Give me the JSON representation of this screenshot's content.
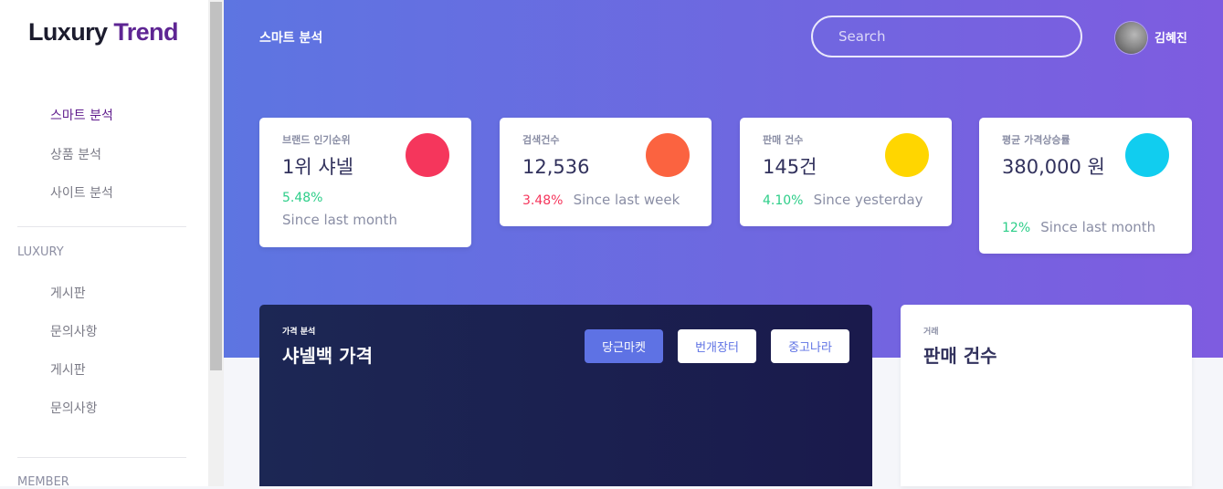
{
  "sidebar": {
    "logo_part1": "Luxury",
    "logo_part2": "Trend",
    "nav": [
      {
        "label": "스마트 분석"
      },
      {
        "label": "상품 분석"
      },
      {
        "label": "사이트 분석"
      }
    ],
    "section_luxury": "LUXURY",
    "luxury_items": [
      {
        "label": "게시판"
      },
      {
        "label": "문의사항"
      },
      {
        "label": "게시판"
      },
      {
        "label": "문의사항"
      }
    ],
    "section_member": "MEMBER"
  },
  "header": {
    "title": "스마트 분석",
    "search_placeholder": "Search",
    "user_name": "김혜진"
  },
  "stats": [
    {
      "label": "브랜드 인기순위",
      "value": "1위 샤넬",
      "change": "5.48%",
      "since": "Since last month",
      "circle_color": "#f5365c"
    },
    {
      "label": "검색건수",
      "value": "12,536",
      "change": "3.48%",
      "since": "Since last week",
      "circle_color": "#fb6340"
    },
    {
      "label": "판매 건수",
      "value": "145건",
      "change": "4.10%",
      "since": "Since yesterday",
      "circle_color": "#ffd600"
    },
    {
      "label": "평균 가격상승률",
      "value": "380,000 원",
      "change": "12%",
      "since": "Since last month",
      "circle_color": "#11cdef"
    }
  ],
  "price_panel": {
    "subtitle": "가격 분석",
    "title": "샤넬백 가격",
    "buttons": [
      "당근마켓",
      "번개장터",
      "중고나라"
    ]
  },
  "sales_panel": {
    "subtitle": "거래",
    "title": "판매 건수"
  }
}
